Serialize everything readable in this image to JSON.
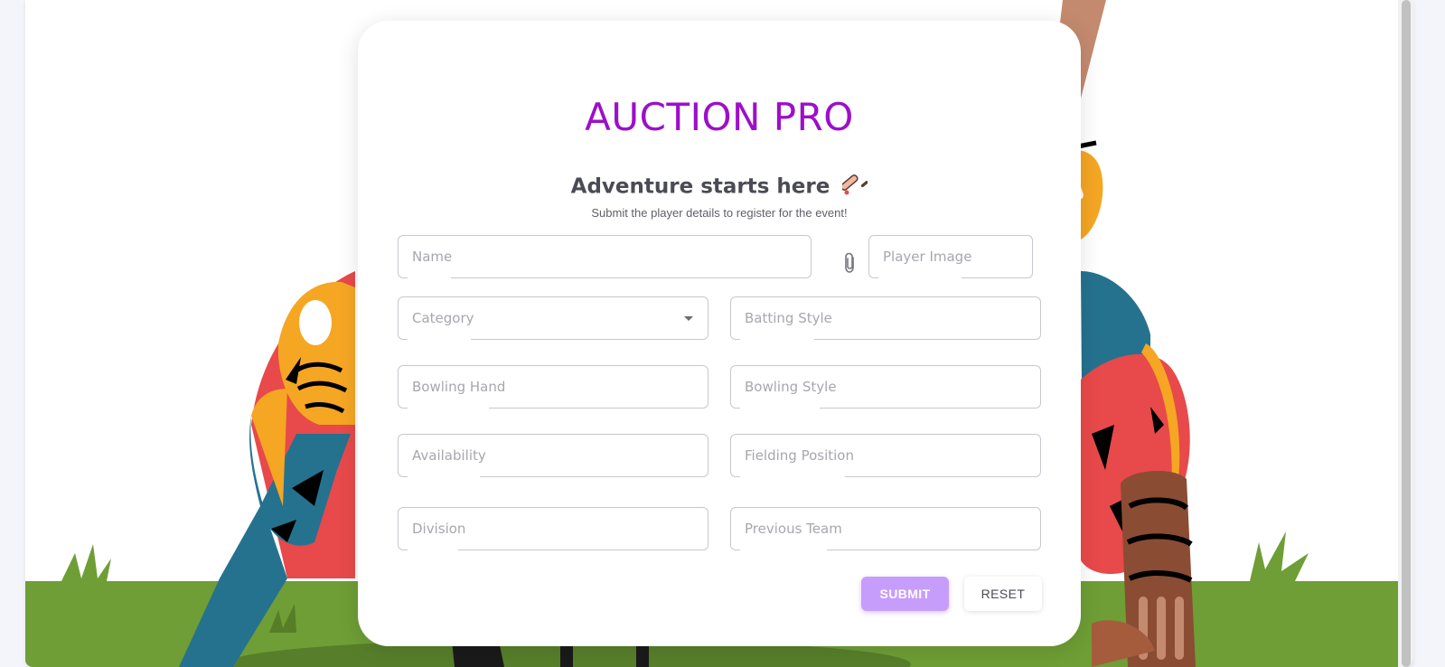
{
  "brand": {
    "title": "AUCTION PRO",
    "color": "#9c10c9"
  },
  "form": {
    "heading": "Adventure starts here",
    "heading_icon": "cricket-bat-icon",
    "subtitle": "Submit the player details to register for the event!",
    "fields": {
      "name": {
        "placeholder": "Name",
        "value": ""
      },
      "player_image": {
        "placeholder": "Player Image",
        "value": "",
        "icon": "paperclip-icon"
      },
      "category": {
        "placeholder": "Category",
        "value": "",
        "type": "select"
      },
      "batting_style": {
        "placeholder": "Batting Style",
        "value": ""
      },
      "bowling_hand": {
        "placeholder": "Bowling Hand",
        "value": ""
      },
      "bowling_style": {
        "placeholder": "Bowling Style",
        "value": ""
      },
      "availability": {
        "placeholder": "Availability",
        "value": ""
      },
      "fielding_position": {
        "placeholder": "Fielding Position",
        "value": ""
      },
      "division": {
        "placeholder": "Division",
        "value": ""
      },
      "previous_team": {
        "placeholder": "Previous Team",
        "value": ""
      }
    },
    "buttons": {
      "submit_label": "SUBMIT",
      "reset_label": "RESET"
    }
  },
  "colors": {
    "submit_bg": "#c79dfc",
    "ground": "#6e9e35",
    "accent_red": "#e8494a",
    "accent_teal": "#25728f",
    "accent_orange": "#f5a623"
  }
}
